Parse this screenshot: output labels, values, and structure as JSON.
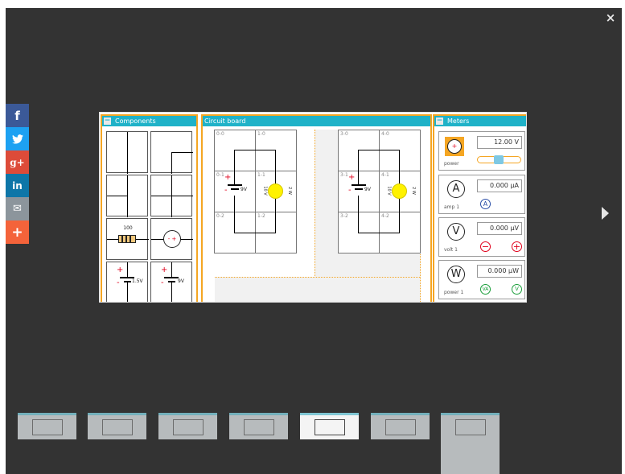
{
  "overlay": {
    "close_label": "×",
    "next_icon": "chevron-right-icon"
  },
  "share": [
    {
      "label": "f",
      "icon": "facebook-icon",
      "color": "#3b5998"
    },
    {
      "label": "t",
      "icon": "twitter-icon",
      "color": "#1da1f2"
    },
    {
      "label": "g+",
      "icon": "google-plus-icon",
      "color": "#dd4b39"
    },
    {
      "label": "in",
      "icon": "linkedin-icon",
      "color": "#0e76a8"
    },
    {
      "label": "✉",
      "icon": "email-icon",
      "color": "#8c959c"
    },
    {
      "label": "+",
      "icon": "plus-icon",
      "color": "#f4633a"
    }
  ],
  "components": {
    "title": "Components",
    "resistor_value": "100",
    "battery_small": "1.5V",
    "battery_large": "9V"
  },
  "board": {
    "title": "Circuit board",
    "left_labels": [
      "0-0",
      "1-0",
      "0-1",
      "1-1",
      "0-2",
      "1-2"
    ],
    "right_labels": [
      "3-0",
      "4-0",
      "3-1",
      "4-1",
      "3-2",
      "4-2"
    ],
    "battery_label": "9V",
    "bulb_label_a": "10 V",
    "bulb_label_b": "2 W"
  },
  "meters": {
    "title": "Meters",
    "items": [
      {
        "name": "power",
        "symbol": "+",
        "value": "12.00",
        "unit": "V",
        "slider": 0.5
      },
      {
        "name": "amp 1",
        "symbol": "A",
        "value": "0.000",
        "unit": "μA"
      },
      {
        "name": "volt 1",
        "symbol": "V",
        "value": "0.000",
        "unit": "μV"
      },
      {
        "name": "power 1",
        "symbol": "W",
        "value": "0.000",
        "unit": "μW"
      }
    ],
    "amp_button": "A",
    "minus_button": "−",
    "plus_button": "+",
    "va_button": "VA",
    "v_button": "V"
  },
  "colors": {
    "accent": "#1fb2c8",
    "border": "#f5a623",
    "bulb": "#fff200",
    "red": "#e0001b"
  }
}
